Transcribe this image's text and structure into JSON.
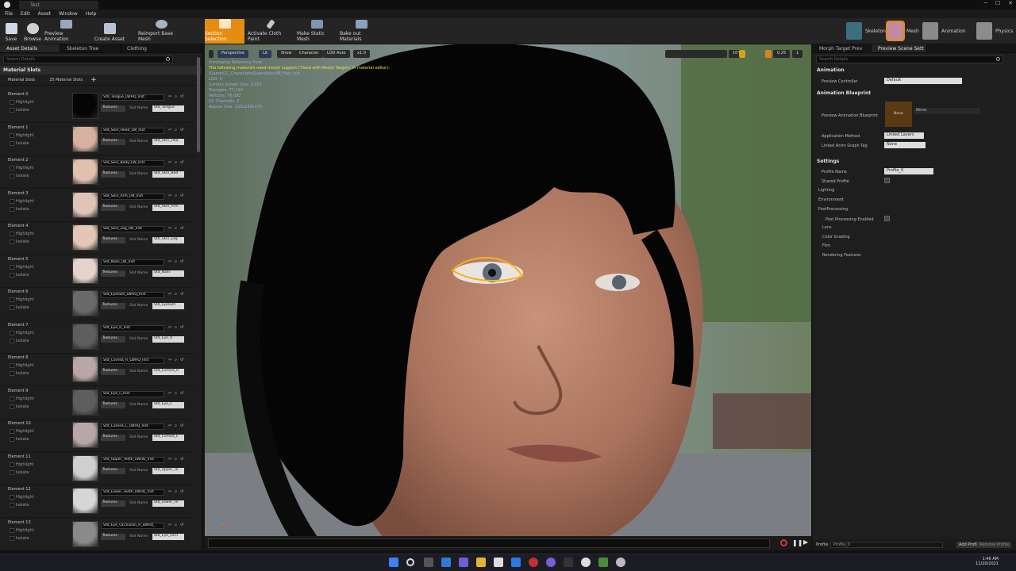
{
  "window": {
    "tab": "Test"
  },
  "menu": [
    "File",
    "Edit",
    "Asset",
    "Window",
    "Help"
  ],
  "toolbar": {
    "save": "Save",
    "browse": "Browse",
    "preview_animation": "Preview Animation",
    "create_asset": "Create Asset",
    "reimport": "Reimport Base Mesh",
    "section_selection": "Section Selection",
    "cloth_paint": "Activate Cloth Paint",
    "make_static": "Make Static Mesh",
    "bake_out": "Bake out Materials"
  },
  "modes": {
    "skeleton": "Skeleton",
    "mesh": "Mesh",
    "animation": "Animation",
    "physics": "Physics"
  },
  "left": {
    "tabs": [
      "Asset Details",
      "Skeleton Tree",
      "Clothing"
    ],
    "search_placeholder": "Search Details",
    "section": "Material Slots",
    "slots_label": "Material Slots",
    "slots_count": "25 Material Slots",
    "highlight": "Highlight",
    "isolate": "Isolate",
    "textures": "Textures",
    "slot_name_label": "Slot Name",
    "elements": [
      {
        "name": "Element 0",
        "material": "Std_Tongue_LWHQ_Inst",
        "slot": "Std_Tongue",
        "color": "#050505"
      },
      {
        "name": "Element 1",
        "material": "Std_Skin_Head_LW_Inst",
        "slot": "Std_Skin_Hea",
        "color": "#d9b0a0"
      },
      {
        "name": "Element 2",
        "material": "Std_Skin_Body_LW_Inst",
        "slot": "Std_Skin_Bod",
        "color": "#e2c0ae"
      },
      {
        "name": "Element 3",
        "material": "Std_Skin_Arm_LW_Inst",
        "slot": "Std_Skin_Arm",
        "color": "#e0c4b6"
      },
      {
        "name": "Element 4",
        "material": "Std_Skin_Leg_LW_Inst",
        "slot": "Std_Skin_Leg",
        "color": "#e3c6b4"
      },
      {
        "name": "Element 5",
        "material": "Std_Nails_LW_Inst",
        "slot": "Std_Nails",
        "color": "#e6d2cc"
      },
      {
        "name": "Element 6",
        "material": "Std_Eyelash_LWHQ_Inst",
        "slot": "Std_Eyelash",
        "color": "#6a6a6a"
      },
      {
        "name": "Element 7",
        "material": "Std_Eye_R_Inst",
        "slot": "Std_Eye_R",
        "color": "#5e5e5e"
      },
      {
        "name": "Element 8",
        "material": "Std_Cornea_R_LWHQ_Inst",
        "slot": "Std_Cornea_R",
        "color": "#b9a7a7"
      },
      {
        "name": "Element 9",
        "material": "Std_Eye_L_Inst",
        "slot": "Std_Eye_L",
        "color": "#5e5e5e"
      },
      {
        "name": "Element 10",
        "material": "Std_Cornea_L_LWHQ_Inst",
        "slot": "Std_Cornea_L",
        "color": "#b9a7a7"
      },
      {
        "name": "Element 11",
        "material": "Std_Upper_Teeth_LWHQ_Inst",
        "slot": "Std_Upper_Te",
        "color": "#cfcfcf"
      },
      {
        "name": "Element 12",
        "material": "Std_Lower_Teeth_LWHQ_Inst",
        "slot": "Std_Lower_Te",
        "color": "#d6d6d6"
      },
      {
        "name": "Element 13",
        "material": "Std_Eye_Occlusion_R_LWHQ_",
        "slot": "Std_Eye_Occl",
        "color": "#8a8a8a"
      }
    ]
  },
  "viewport": {
    "perspective": "Perspective",
    "lit": "Lit",
    "show": "Show",
    "character": "Character",
    "lod": "LOD Auto",
    "speed": "x1.0",
    "info": [
      "Previewing Reference Pose",
      "The following materials need morph support ('Used with Morph Targets' in material editor):",
      "/Game/CC_Characters/Gwendolyn/M_Hair_Inst",
      "LOD: 0",
      "Current Screen Size: 3.051",
      "Triangles: 77,192",
      "Vertices: 76,082",
      "UV Channels: 2",
      "Approx Size: 120x239x175"
    ],
    "angle": "10°",
    "scale": "0.25",
    "cam_speed": "1"
  },
  "right": {
    "tabs": [
      "Morph Target Prev",
      "Preview Scene Sett"
    ],
    "search_placeholder": "Search Details",
    "animation": "Animation",
    "preview_controller": "Preview Controller",
    "preview_controller_val": "Default",
    "anim_bp": "Animation Blueprint",
    "preview_anim_bp": "Preview Animation Blueprint",
    "bp_thumb": "None",
    "bp_val": "None",
    "app_method": "Application Method",
    "app_method_val": "Linked Layers",
    "linked_tag": "Linked Anim Graph Tag",
    "linked_tag_val": "None",
    "settings": "Settings",
    "profile_name": "Profile Name",
    "profile_name_val": "Profile_0",
    "shared_profile": "Shared Profile",
    "lighting": "Lighting",
    "environment": "Environment",
    "postprocessing": "PostProcessing",
    "pp_enabled": "Post Processing Enabled",
    "lens": "Lens",
    "color_grading": "Color Grading",
    "film": "Film",
    "rendering": "Rendering Features",
    "profile_label": "Profile",
    "profile_dd": "Profile_0",
    "add_profile": "Add Profile",
    "remove_profile": "Remove Profile"
  },
  "taskbar": {
    "time": "1:46 AM",
    "date": "11/20/2021"
  }
}
